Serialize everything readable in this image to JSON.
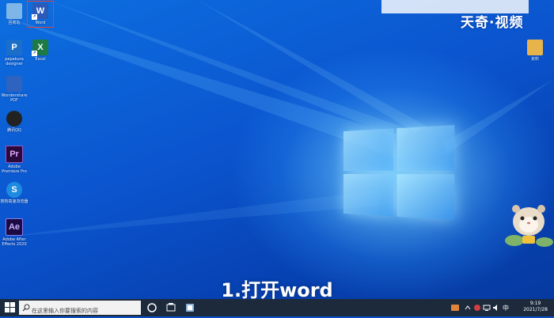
{
  "desktop": {
    "icons": [
      {
        "id": "recycle-bin",
        "label": "回收站",
        "glyph": "",
        "color": "#7fb6e8"
      },
      {
        "id": "word",
        "label": "Word",
        "glyph": "W",
        "color": "#2b5ab8"
      },
      {
        "id": "pepakura",
        "label": "pepakura designer",
        "glyph": "P",
        "color": "#1b6fc9"
      },
      {
        "id": "excel",
        "label": "Excel",
        "glyph": "X",
        "color": "#1d7a45"
      },
      {
        "id": "photoshop",
        "label": "Wondershare PDF",
        "glyph": "",
        "color": "#2e63c0"
      },
      {
        "id": "qq",
        "label": "腾讯QQ",
        "glyph": "",
        "color": "#222222"
      },
      {
        "id": "premiere",
        "label": "Adobe Premiere Pro",
        "glyph": "Pr",
        "color": "#2a0a3a"
      },
      {
        "id": "sogou",
        "label": "搜狗高速浏览器",
        "glyph": "S",
        "color": "#1e8be0"
      },
      {
        "id": "after-effects",
        "label": "Adobe After Effects 2020",
        "glyph": "Ae",
        "color": "#1b0b42"
      },
      {
        "id": "folder",
        "label": "资料",
        "glyph": "",
        "color": "#e6b44a"
      }
    ],
    "watermark": "天奇·视频",
    "caption": "1.打开word"
  },
  "taskbar": {
    "search_placeholder": "在这里输入你要搜索的内容",
    "time": "9:19",
    "date": "2021/7/28"
  },
  "colors": {
    "taskbar": "#1c2a3c",
    "selection": "#e04040",
    "desktop": "#0b55cf"
  }
}
